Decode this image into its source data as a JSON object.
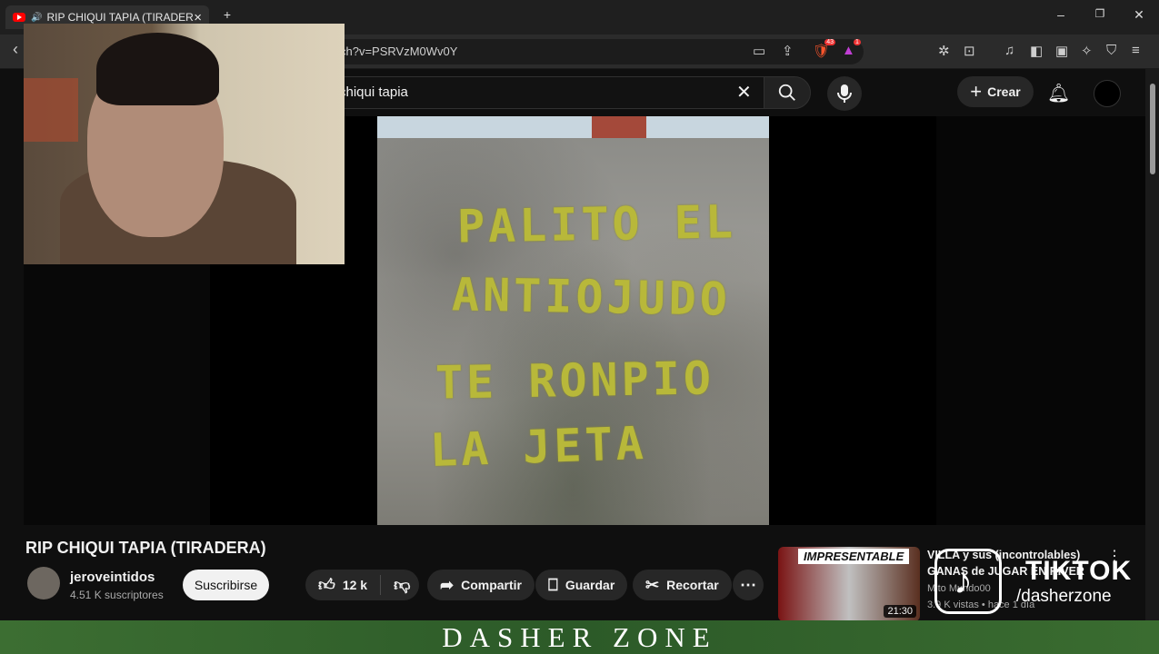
{
  "tab": {
    "title": "RIP CHIQUI TAPIA (TIRADERA)",
    "close": "×",
    "new_tab": "+"
  },
  "window": {
    "minimize": "–",
    "maximize": "❐",
    "close": "✕"
  },
  "address": {
    "url": "ch?v=PSRVzM0Wv0Y",
    "brave_count": "43",
    "alert_count": "1"
  },
  "youtube": {
    "search_value": "chiqui tapia",
    "create_label": "Crear"
  },
  "video": {
    "graffiti_lines": [
      "PALITO EL",
      "ANTIOJUDO",
      "TE RONPIO",
      "LA JETA"
    ],
    "title": "RIP CHIQUI TAPIA (TIRADERA)",
    "channel": "jeroveintidos",
    "subscribers": "4.51 K suscriptores",
    "subscribe_label": "Suscribirse",
    "likes": "12 k",
    "share_label": "Compartir",
    "save_label": "Guardar",
    "clip_label": "Recortar"
  },
  "recommended": {
    "title": "VILLA y sus (incontrolables) GANAS de JUGAR EN RIVER",
    "channel": "Mito Mundo00",
    "meta": "3.9 K vistas • hace 1 día",
    "banner": "IMPRESENTABLE",
    "duration": "21:30"
  },
  "overlay": {
    "tiktok_name": "TIKTOK",
    "tiktok_handle": "/dasherzone",
    "footer_banner": "DASHER ZONE"
  },
  "colors": {
    "accent": "#ff0000",
    "subscribe_bg": "#f1f1f1",
    "banner_green": "#2c5a28",
    "graffiti": "#b8b83a"
  }
}
